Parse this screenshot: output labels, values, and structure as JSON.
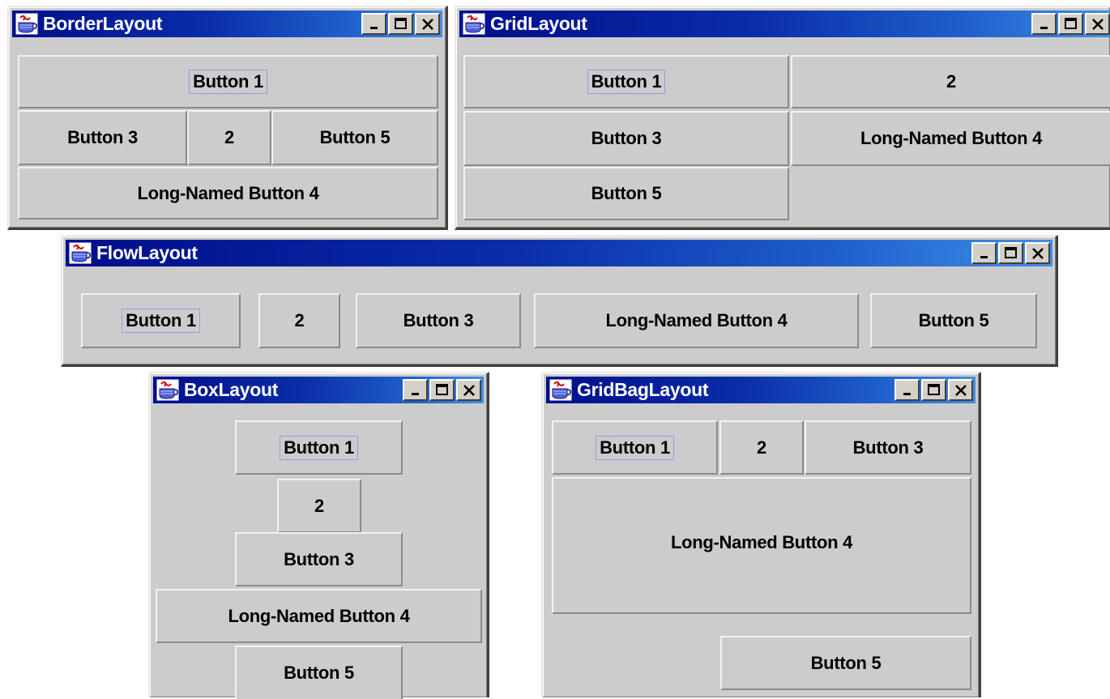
{
  "windows": {
    "border": {
      "title": "BorderLayout",
      "buttons": {
        "b1": "Button 1",
        "b3": "Button 3",
        "b2": "2",
        "b5": "Button 5",
        "b4": "Long-Named Button 4"
      }
    },
    "grid": {
      "title": "GridLayout",
      "buttons": {
        "b1": "Button 1",
        "b2": "2",
        "b3": "Button 3",
        "b4": "Long-Named Button 4",
        "b5": "Button 5"
      }
    },
    "flow": {
      "title": "FlowLayout",
      "buttons": {
        "b1": "Button 1",
        "b2": "2",
        "b3": "Button 3",
        "b4": "Long-Named Button 4",
        "b5": "Button 5"
      }
    },
    "box": {
      "title": "BoxLayout",
      "buttons": {
        "b1": "Button 1",
        "b2": "2",
        "b3": "Button 3",
        "b4": "Long-Named Button 4",
        "b5": "Button 5"
      }
    },
    "gridbag": {
      "title": "GridBagLayout",
      "buttons": {
        "b1": "Button 1",
        "b2": "2",
        "b3": "Button 3",
        "b4": "Long-Named Button 4",
        "b5": "Button 5"
      }
    }
  },
  "controls": {
    "minimize_icon": "minimize-icon",
    "maximize_icon": "maximize-icon",
    "close_icon": "close-icon",
    "app_icon": "java-cup-icon"
  },
  "colors": {
    "titlebar_start": "#000e8c",
    "titlebar_end": "#3f8fe6",
    "window_bg": "#cccccc",
    "focus_ring": "#9a9ad8"
  }
}
